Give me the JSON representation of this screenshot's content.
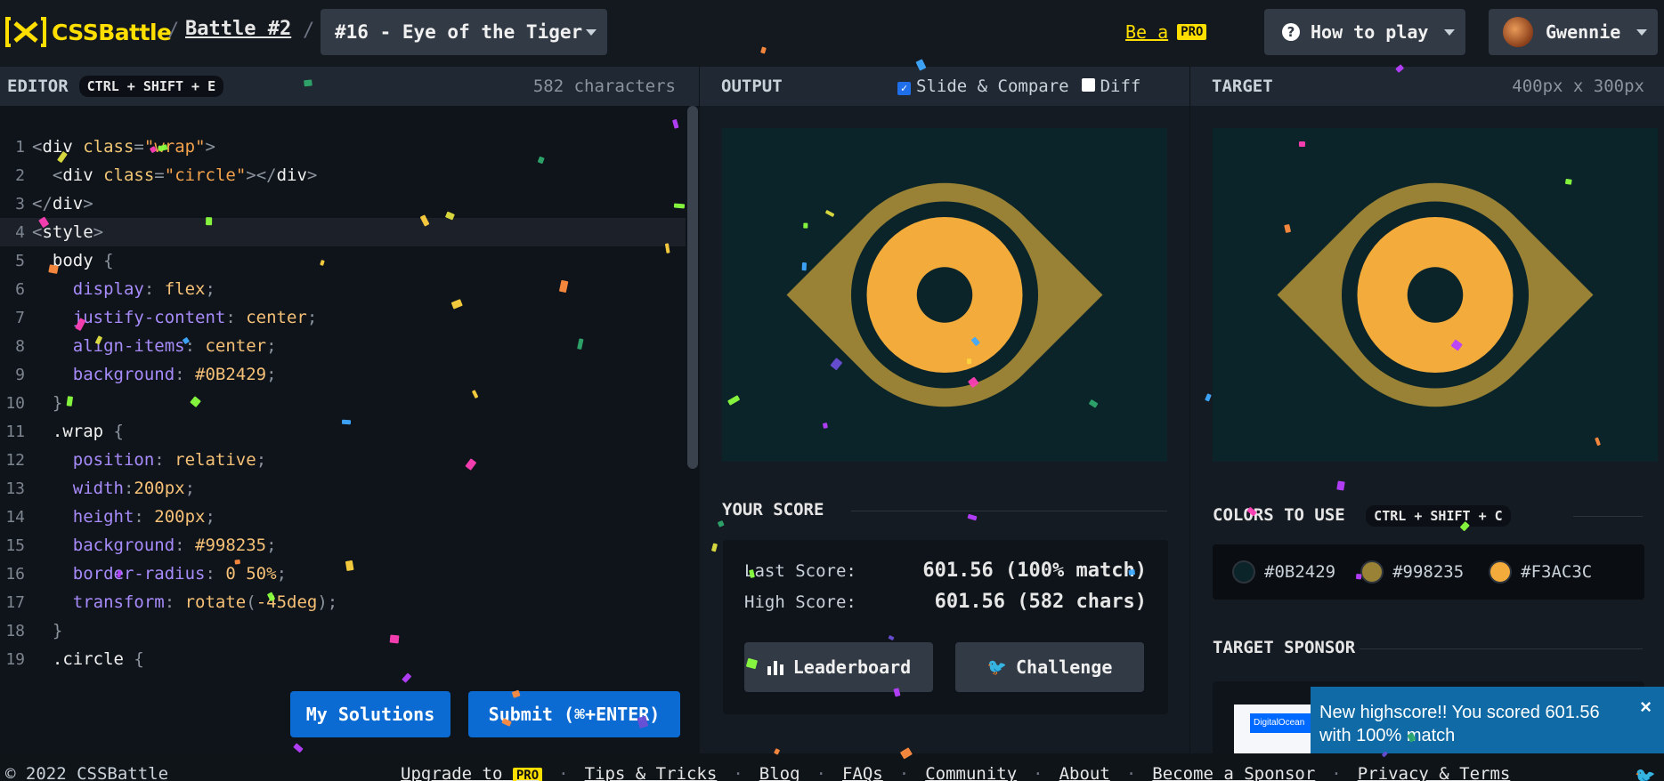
{
  "header": {
    "logo_text": "CSSBattle",
    "crumb_separator": "/",
    "battle_link": "Battle #2",
    "target_select": "#16 - Eye of the Tiger",
    "be_a": "Be a",
    "pro_badge": "PRO",
    "how_to_play": "How to play",
    "user_name": "Gwennie"
  },
  "editor": {
    "title": "EDITOR",
    "shortcut": "CTRL + SHIFT + E",
    "char_count": "582 characters",
    "lines": [
      {
        "n": "1",
        "parts": [
          [
            "t-punc",
            "<"
          ],
          [
            "t-tag",
            "div "
          ],
          [
            "t-attr",
            "class"
          ],
          [
            "t-punc",
            "="
          ],
          [
            "t-str",
            "\"wrap\""
          ],
          [
            "t-punc",
            ">"
          ]
        ]
      },
      {
        "n": "2",
        "parts": [
          [
            "t-punc",
            "  <"
          ],
          [
            "t-tag",
            "div "
          ],
          [
            "t-attr",
            "class"
          ],
          [
            "t-punc",
            "="
          ],
          [
            "t-str",
            "\"circle\""
          ],
          [
            "t-punc",
            "></"
          ],
          [
            "t-tag",
            "div"
          ],
          [
            "t-punc",
            ">"
          ]
        ]
      },
      {
        "n": "3",
        "parts": [
          [
            "t-punc",
            "</"
          ],
          [
            "t-tag",
            "div"
          ],
          [
            "t-punc",
            ">"
          ]
        ]
      },
      {
        "n": "4",
        "parts": [
          [
            "t-punc",
            "<"
          ],
          [
            "t-tag",
            "style"
          ],
          [
            "t-punc",
            ">"
          ]
        ],
        "active": true
      },
      {
        "n": "5",
        "parts": [
          [
            "t-sel",
            "  body "
          ],
          [
            "t-punc",
            "{"
          ]
        ]
      },
      {
        "n": "6",
        "parts": [
          [
            "t-prop",
            "    display"
          ],
          [
            "t-punc",
            ": "
          ],
          [
            "t-val",
            "flex"
          ],
          [
            "t-punc",
            ";"
          ]
        ]
      },
      {
        "n": "7",
        "parts": [
          [
            "t-prop",
            "    justify-content"
          ],
          [
            "t-punc",
            ": "
          ],
          [
            "t-val",
            "center"
          ],
          [
            "t-punc",
            ";"
          ]
        ]
      },
      {
        "n": "8",
        "parts": [
          [
            "t-prop",
            "    align-items"
          ],
          [
            "t-punc",
            ": "
          ],
          [
            "t-val",
            "center"
          ],
          [
            "t-punc",
            ";"
          ]
        ]
      },
      {
        "n": "9",
        "parts": [
          [
            "t-prop",
            "    background"
          ],
          [
            "t-punc",
            ": "
          ],
          [
            "t-val",
            "#0B2429"
          ],
          [
            "t-punc",
            ";"
          ]
        ]
      },
      {
        "n": "10",
        "parts": [
          [
            "t-punc",
            "  }"
          ]
        ]
      },
      {
        "n": "11",
        "parts": [
          [
            "t-sel",
            "  .wrap "
          ],
          [
            "t-punc",
            "{"
          ]
        ]
      },
      {
        "n": "12",
        "parts": [
          [
            "t-prop",
            "    position"
          ],
          [
            "t-punc",
            ": "
          ],
          [
            "t-val",
            "relative"
          ],
          [
            "t-punc",
            ";"
          ]
        ]
      },
      {
        "n": "13",
        "parts": [
          [
            "t-prop",
            "    width"
          ],
          [
            "t-punc",
            ":"
          ],
          [
            "t-val",
            "200px"
          ],
          [
            "t-punc",
            ";"
          ]
        ]
      },
      {
        "n": "14",
        "parts": [
          [
            "t-prop",
            "    height"
          ],
          [
            "t-punc",
            ": "
          ],
          [
            "t-val",
            "200px"
          ],
          [
            "t-punc",
            ";"
          ]
        ]
      },
      {
        "n": "15",
        "parts": [
          [
            "t-prop",
            "    background"
          ],
          [
            "t-punc",
            ": "
          ],
          [
            "t-val",
            "#998235"
          ],
          [
            "t-punc",
            ";"
          ]
        ]
      },
      {
        "n": "16",
        "parts": [
          [
            "t-prop",
            "    border-radius"
          ],
          [
            "t-punc",
            ": "
          ],
          [
            "t-val",
            "0 50%"
          ],
          [
            "t-punc",
            ";"
          ]
        ]
      },
      {
        "n": "17",
        "parts": [
          [
            "t-prop",
            "    transform"
          ],
          [
            "t-punc",
            ": "
          ],
          [
            "t-val",
            "rotate"
          ],
          [
            "t-punc",
            "("
          ],
          [
            "t-val",
            "-45deg"
          ],
          [
            "t-punc",
            ");"
          ]
        ]
      },
      {
        "n": "18",
        "parts": [
          [
            "t-punc",
            "  }"
          ]
        ]
      },
      {
        "n": "19",
        "parts": [
          [
            "t-sel",
            "  .circle "
          ],
          [
            "t-punc",
            "{"
          ]
        ]
      }
    ],
    "my_solutions": "My Solutions",
    "submit": "Submit (⌘+ENTER)"
  },
  "output": {
    "title": "OUTPUT",
    "slide_compare": "Slide & Compare",
    "diff": "Diff",
    "your_score": "YOUR SCORE",
    "last_score_label": "Last Score:",
    "last_score_value": "601.56 (100% match)",
    "high_score_label": "High Score:",
    "high_score_value": "601.56 (582 chars)",
    "leaderboard": "Leaderboard",
    "challenge": "Challenge"
  },
  "target": {
    "title": "TARGET",
    "dims": "400px x 300px",
    "colors_title": "COLORS TO USE",
    "colors_shortcut": "CTRL + SHIFT + C",
    "colors": [
      "#0B2429",
      "#998235",
      "#F3AC3C"
    ],
    "sponsor_title": "TARGET SPONSOR",
    "sponsor_img_text": "DigitalOcean"
  },
  "toast": {
    "message": "New highscore!! You scored 601.56 with 100% match",
    "close": "×"
  },
  "footer": {
    "copyright": "© 2022 CSSBattle",
    "upgrade": "Upgrade to",
    "pro_badge": "PRO",
    "links": [
      "Tips & Tricks",
      "Blog",
      "FAQs",
      "Community",
      "About",
      "Become a Sponsor",
      "Privacy & Terms"
    ]
  },
  "theme": {
    "accent_yellow": "#ffdf00",
    "button_blue": "#0b6bd3",
    "canvas_bg": "#0B2429",
    "eye_gold": "#998235",
    "iris_orange": "#F3AC3C"
  }
}
